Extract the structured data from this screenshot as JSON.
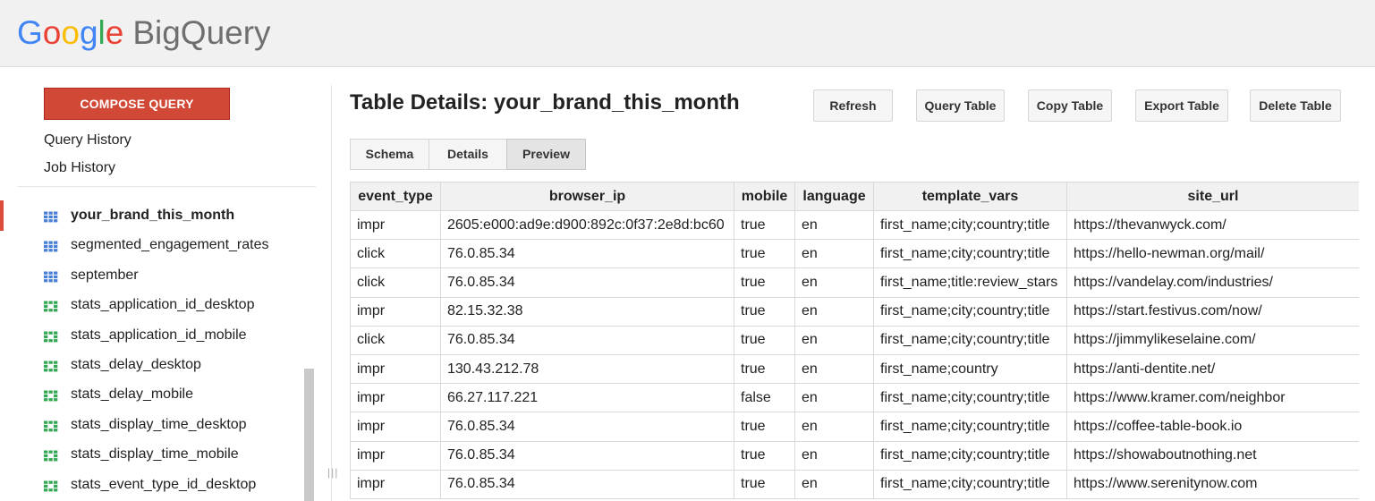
{
  "app": {
    "logo_google": [
      "G",
      "o",
      "o",
      "g",
      "l",
      "e"
    ],
    "product_name": "BigQuery"
  },
  "sidebar": {
    "compose_label": "COMPOSE QUERY",
    "query_history": "Query History",
    "job_history": "Job History",
    "tables": [
      {
        "name": "your_brand_this_month",
        "icon": "table-icon",
        "active": true
      },
      {
        "name": "segmented_engagement_rates",
        "icon": "table-icon"
      },
      {
        "name": "september",
        "icon": "table-icon"
      },
      {
        "name": "stats_application_id_desktop",
        "icon": "view-icon"
      },
      {
        "name": "stats_application_id_mobile",
        "icon": "view-icon"
      },
      {
        "name": "stats_delay_desktop",
        "icon": "view-icon"
      },
      {
        "name": "stats_delay_mobile",
        "icon": "view-icon"
      },
      {
        "name": "stats_display_time_desktop",
        "icon": "view-icon"
      },
      {
        "name": "stats_display_time_mobile",
        "icon": "view-icon"
      },
      {
        "name": "stats_event_type_id_desktop",
        "icon": "view-icon"
      }
    ]
  },
  "main": {
    "title": "Table Details: your_brand_this_month",
    "toolbar": {
      "refresh": "Refresh",
      "query_table": "Query Table",
      "copy_table": "Copy Table",
      "export_table": "Export Table",
      "delete_table": "Delete Table"
    },
    "tabs": [
      {
        "label": "Schema"
      },
      {
        "label": "Details"
      },
      {
        "label": "Preview",
        "selected": true
      }
    ],
    "table": {
      "columns": [
        "event_type",
        "browser_ip",
        "mobile",
        "language",
        "template_vars",
        "site_url"
      ],
      "rows": [
        [
          "impr",
          "2605:e000:ad9e:d900:892c:0f37:2e8d:bc60",
          "true",
          "en",
          "first_name;city;country;title",
          "https://thevanwyck.com/"
        ],
        [
          "click",
          "76.0.85.34",
          "true",
          "en",
          "first_name;city;country;title",
          "https://hello-newman.org/mail/"
        ],
        [
          "click",
          "76.0.85.34",
          "true",
          "en",
          "first_name;title:review_stars",
          "https://vandelay.com/industries/"
        ],
        [
          "impr",
          "82.15.32.38",
          "true",
          "en",
          "first_name;city;country;title",
          "https://start.festivus.com/now/"
        ],
        [
          "click",
          "76.0.85.34",
          "true",
          "en",
          "first_name;city;country;title",
          "https://jimmylikeselaine.com/"
        ],
        [
          "impr",
          "130.43.212.78",
          "true",
          "en",
          "first_name;country",
          "https://anti-dentite.net/"
        ],
        [
          "impr",
          "66.27.117.221",
          "false",
          "en",
          "first_name;city;country;title",
          "https://www.kramer.com/neighbor"
        ],
        [
          "impr",
          "76.0.85.34",
          "true",
          "en",
          "first_name;city;country;title",
          "https://coffee-table-book.io"
        ],
        [
          "impr",
          "76.0.85.34",
          "true",
          "en",
          "first_name;city;country;title",
          "https://showaboutnothing.net"
        ],
        [
          "impr",
          "76.0.85.34",
          "true",
          "en",
          "first_name;city;country;title",
          "https://www.serenitynow.com"
        ]
      ]
    }
  },
  "colors": {
    "compose": "#d14836",
    "active_marker": "#dd4b39",
    "table_icon": "#4a7fd6",
    "view_icon": "#34a853"
  }
}
